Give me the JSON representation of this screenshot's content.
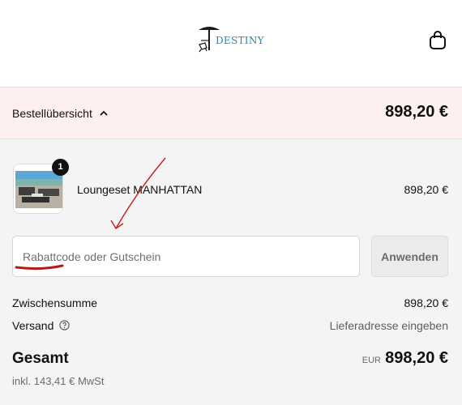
{
  "header": {
    "logo_text": "DESTINY",
    "cart_icon": "shopping-bag-icon"
  },
  "summary": {
    "label": "Bestellübersicht",
    "chevron_icon": "chevron-up-icon",
    "total": "898,20 €"
  },
  "line_item": {
    "quantity": "1",
    "name": "Loungeset MANHATTAN",
    "price": "898,20 €"
  },
  "discount": {
    "placeholder": "Rabattcode oder Gutschein",
    "value": "",
    "apply_label": "Anwenden"
  },
  "totals": {
    "subtotal_label": "Zwischensumme",
    "subtotal_value": "898,20 €",
    "shipping_label": "Versand",
    "shipping_help_icon": "question-circle-icon",
    "shipping_value": "Lieferadresse eingeben",
    "total_label": "Gesamt",
    "currency": "EUR",
    "total_value": "898,20 €",
    "tax_note": "inkl. 143,41 € MwSt"
  },
  "colors": {
    "summary_bg": "#fdf0ee",
    "logo_blue": "#2a86a9",
    "annotation_red": "#c81d1d"
  }
}
